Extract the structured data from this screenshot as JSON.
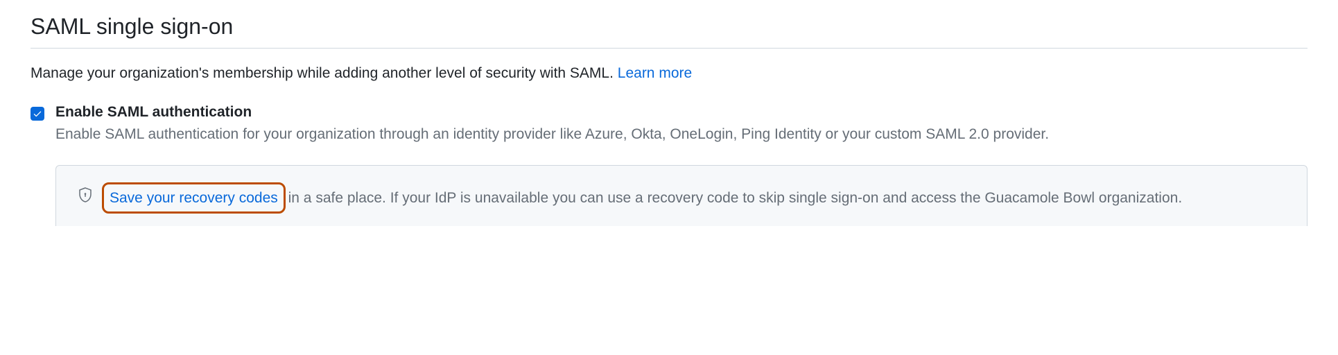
{
  "section": {
    "title": "SAML single sign-on",
    "description": "Manage your organization's membership while adding another level of security with SAML. ",
    "learn_more_label": "Learn more"
  },
  "checkbox": {
    "checked": true,
    "label": "Enable SAML authentication",
    "description": "Enable SAML authentication for your organization through an identity provider like Azure, Okta, OneLogin, Ping Identity or your custom SAML 2.0 provider."
  },
  "alert": {
    "link_text": "Save your recovery codes",
    "text_after": " in a safe place. If your IdP is unavailable you can use a recovery code to skip single sign-on and access the Guacamole Bowl organization."
  }
}
